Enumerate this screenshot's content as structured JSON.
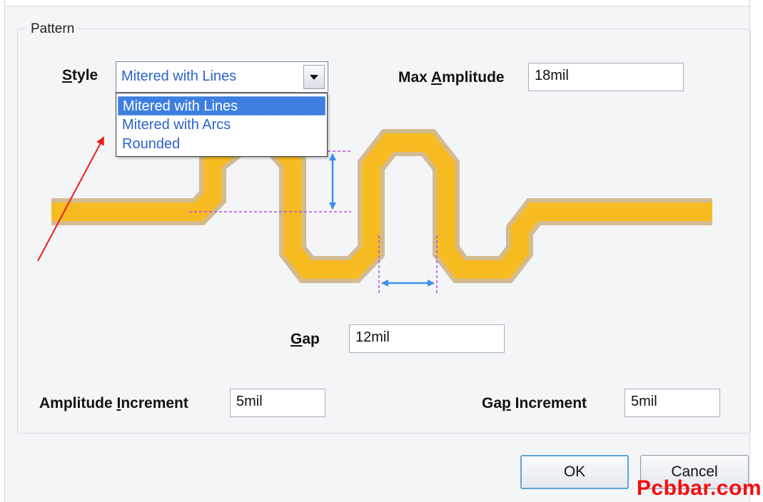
{
  "pattern_group": {
    "title": "Pattern"
  },
  "style": {
    "label_lead": "S",
    "label_rest": "tyle",
    "selected": "Mitered with Lines",
    "options": [
      "Mitered with Lines",
      "Mitered with Arcs",
      "Rounded"
    ]
  },
  "max_amplitude": {
    "label_lead": "Max ",
    "label_ul": "A",
    "label_rest": "mplitude",
    "value": "18mil"
  },
  "gap": {
    "label_ul": "G",
    "label_rest": "ap",
    "value": "12mil"
  },
  "amplitude_increment": {
    "label_lead": "Amplitude ",
    "label_ul": "I",
    "label_rest": "ncrement",
    "value": "5mil"
  },
  "gap_increment": {
    "label_lead": "Ga",
    "label_ul": "p",
    "label_rest": " Increment",
    "value": "5mil"
  },
  "buttons": {
    "ok": "OK",
    "cancel": "Cancel"
  },
  "watermark": "Pcbbar.com",
  "colors": {
    "trace": "#f7bb22",
    "trace_glow": "#b88a3e",
    "dimension_arrow": "#3c8ff0",
    "guide_line": "#b04df0",
    "pointer_arrow": "#f01c1c"
  }
}
